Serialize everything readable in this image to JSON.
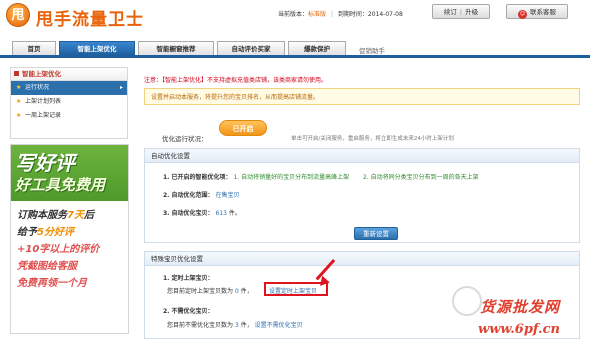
{
  "header": {
    "logo_char": "甩",
    "brand": "甩手流量卫士",
    "version_label": "当前版本：",
    "version_value": "标准版",
    "expiry_label": "到期时间：",
    "expiry_value": "2014-07-08",
    "renew_label": "续订",
    "upgrade_label": "升级",
    "contact_label": "联系客服"
  },
  "nav": {
    "tabs": [
      {
        "label": "首页"
      },
      {
        "label": "智能上架优化"
      },
      {
        "label": "智能橱窗推荐"
      },
      {
        "label": "自动评价买家"
      },
      {
        "label": "爆款保护"
      },
      {
        "label": "促销助手"
      }
    ]
  },
  "sidebar": {
    "title": "智能上架优化",
    "items": [
      {
        "label": "运行状况"
      },
      {
        "label": "上架计划列表"
      },
      {
        "label": "一周上架记录"
      }
    ]
  },
  "promo": {
    "line1": "写好评",
    "line2": "好工具免费用",
    "line3_a": "订购本服务",
    "line3_b": "7天",
    "line3_c": "后",
    "line4_a": "给予",
    "line4_b": "5分好评",
    "line5": "+10字以上的评价",
    "line6": "凭截图给客服",
    "line7": "免费再领一个月"
  },
  "main": {
    "warning_prefix": "注意：",
    "warning_text": "【智能上架优化】不支持虚拟充值类店铺，该类商家请勿使用。",
    "info_text": "设置并启动本服务，将提升您的宝贝排名，从而提高店铺流量。",
    "status_label": "优化运行状况：",
    "status_button": "已开启",
    "status_hint": "单击可开启/关闭服务，重启服务，将立即生成未来24小时上架计划",
    "auto_panel": {
      "title": "自动优化设置",
      "row1_label": "1. 已开启的智能优化项：",
      "row1_item1": "1. 自动将销量好的宝贝分布到流量高峰上架",
      "row1_item2": "2. 自动将同分类宝贝分布到一周的各天上架",
      "row2_label": "2. 自动优化范围：",
      "row2_value": "在售宝贝",
      "row3_label": "3. 自动优化宝贝：",
      "row3_value": "613",
      "row3_unit": "件。",
      "button": "重新设置"
    },
    "special_panel": {
      "title": "特殊宝贝优化设置",
      "row1_label": "1. 定时上架宝贝：",
      "row1_text_a": "您目前定时上架宝贝数为",
      "row1_value": "0",
      "row1_text_b": "件，",
      "row1_link": "设置定时上架宝贝",
      "row2_label": "2. 不需优化宝贝：",
      "row2_text_a": "您目前不需优化宝贝数为",
      "row2_value": "3",
      "row2_text_b": "件，",
      "row2_link": "设置不需优化宝贝"
    }
  },
  "watermark": {
    "line1": "货源批发网",
    "line2": "www.6pf.cn"
  }
}
